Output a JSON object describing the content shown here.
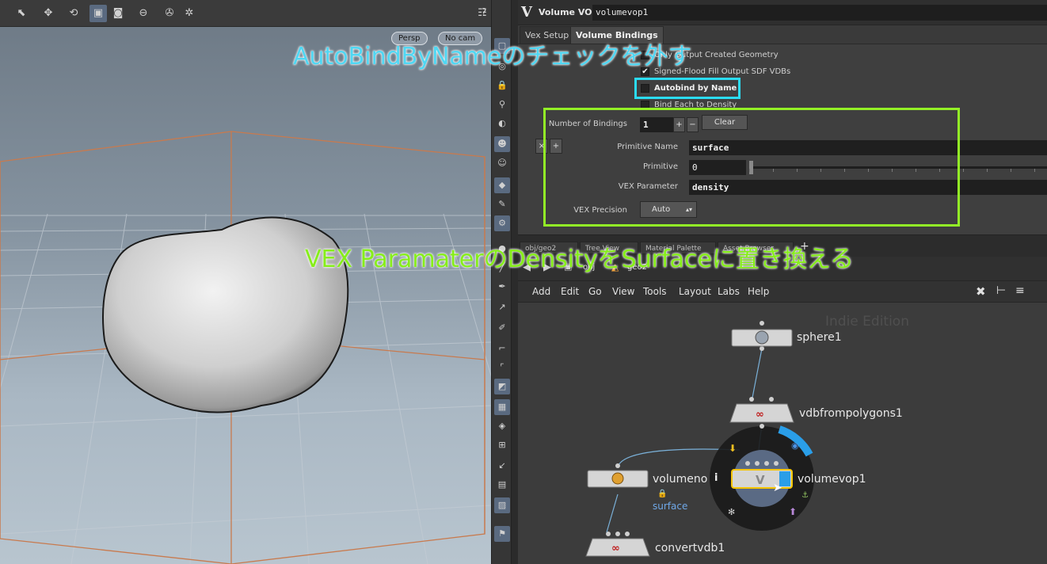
{
  "viewport": {
    "toolbar_icons": [
      "select-icon",
      "move-icon",
      "rotate-icon",
      "camera-icon",
      "capture-icon",
      "stop-icon",
      "flipbook-icon",
      "render-icon",
      "display-options-icon",
      "help-icon"
    ],
    "persp_label": "Persp",
    "cam_label": "No cam"
  },
  "params": {
    "node_type": "Volume VOP",
    "node_type_icon": "V",
    "node_name": "volumevop1",
    "tabs": [
      {
        "label": "Vex Setup",
        "active": false
      },
      {
        "label": "Volume Bindings",
        "active": true
      }
    ],
    "toggles": [
      {
        "label": "Only Output Created Geometry",
        "checked": false
      },
      {
        "label": "Signed-Flood Fill Output SDF VDBs",
        "checked": true
      },
      {
        "label": "Autobind by Name",
        "checked": false
      },
      {
        "label": "Bind Each to Density",
        "checked": false
      }
    ],
    "num_bindings_label": "Number of Bindings",
    "num_bindings_value": "1",
    "plus_label": "+",
    "minus_label": "−",
    "clear_label": "Clear",
    "remove_label": "×",
    "insert_label": "+",
    "primitive_name_label": "Primitive Name",
    "primitive_name_value": "surface",
    "primitive_label": "Primitive",
    "primitive_value": "0",
    "vex_parameter_label": "VEX Parameter",
    "vex_parameter_value": "density",
    "vex_precision_label": "VEX Precision",
    "vex_precision_value": "Auto"
  },
  "annotations": {
    "top": "AutoBindByNameのチェックを外す",
    "middle": "VEX  ParamaterのDensityをSurfaceに置き換える"
  },
  "network": {
    "tabs": [
      "obj/geo2",
      "Tree View",
      "Material Palette",
      "Asset Browser"
    ],
    "path": [
      "obj",
      "geo2"
    ],
    "menu": [
      "Add",
      "Edit",
      "Go",
      "View",
      "Tools",
      "Layout",
      "Labs",
      "Help"
    ],
    "watermark": "Indie Edition",
    "nodes": [
      {
        "name": "sphere1"
      },
      {
        "name": "vdbfrompolygons1"
      },
      {
        "name": "volumenoise1",
        "visible_name": "volumeno"
      },
      {
        "name": "volumevop1"
      },
      {
        "name": "convertvdb1"
      }
    ],
    "wire_label": "surface",
    "info_glyph": "i",
    "colors": {
      "highlight_cyan": "#2bdcf4",
      "highlight_green": "#93f026",
      "selected_node": "#f5c400",
      "node_body": "#d5d5d5"
    }
  }
}
